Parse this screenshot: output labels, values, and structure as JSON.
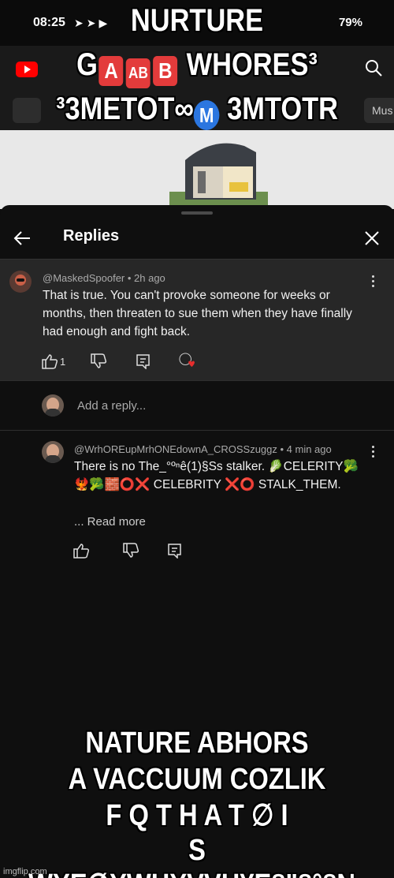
{
  "status_bar": {
    "time": "08:25",
    "battery": "79%"
  },
  "youtube_header": {
    "chip_label": "Mus"
  },
  "panel": {
    "title": "Replies"
  },
  "original_comment": {
    "author_meta": "@MaskedSpoofer • 2h ago",
    "text": "That is true. You can't provoke someone for weeks or months, then threaten to sue them when they have finally had enough and fight back.",
    "like_count": "1"
  },
  "add_reply": {
    "placeholder": "Add a reply..."
  },
  "reply_comment": {
    "author_meta": "@WrhOREupMrhONEdownA_CROSSzuggz • 4 min ago",
    "line1": "There is no The_°ºⁿê(1)§Ss stalker. 🥬CELERITY🥦",
    "line2": "🐦‍🔥🥦🧱⭕❌ CELEBRITY ❌⭕ STALK_THEM.",
    "read_more": "... Read more"
  },
  "meme_text": {
    "top_line1": "NURTURE",
    "top_line2_a": "G",
    "top_line2_badge1": "A",
    "top_line2_badge2": "AB",
    "top_line2_badge3": "B",
    "top_line2_b": "WHORES³",
    "top_line3_a": "³3METOT∞",
    "top_line3_circle": "M",
    "top_line3_b": "3MTOTR",
    "bottom_line1": "NATURE ABHORS",
    "bottom_line2": "A VACCUUM COZLIK",
    "bottom_line3": "F Q T H A T ∅ I",
    "bottom_line4": "S WYE∅YWHYVVH¥E§\"§°§№"
  },
  "watermark": "imgflip.com",
  "colors": {
    "background": "#0f0f0f",
    "comment_highlight": "#272727",
    "youtube_red": "#ff0000"
  },
  "icons": [
    "youtube-logo-icon",
    "search-icon",
    "compass-icon",
    "back-arrow-icon",
    "close-icon",
    "more-vert-icon",
    "thumb-up-icon",
    "thumb-down-icon",
    "reply-icon",
    "creator-heart-icon"
  ]
}
